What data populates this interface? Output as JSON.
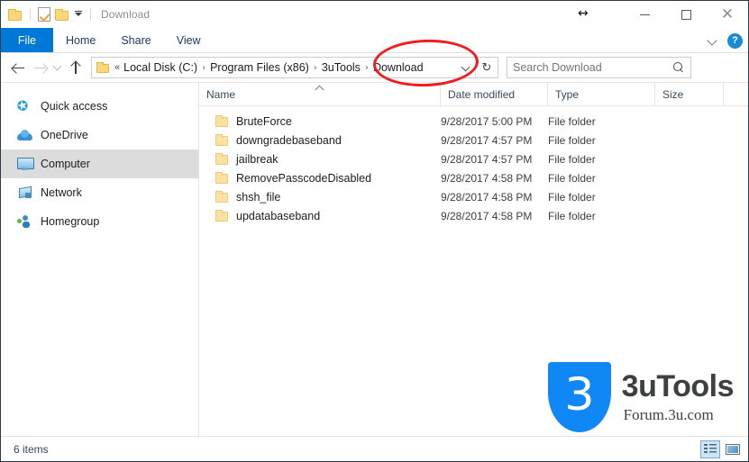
{
  "window": {
    "title": "Download",
    "quick_access_toolbar": [
      {
        "name": "folder-icon",
        "label": "Folder"
      },
      {
        "name": "properties-icon",
        "label": "Properties"
      },
      {
        "name": "new-folder-icon",
        "label": "New folder"
      },
      {
        "name": "customize-dropdown-icon",
        "label": "Customize Quick Access Toolbar"
      }
    ],
    "controls": {
      "minimize": "—",
      "maximize": "□",
      "close": "✕"
    },
    "cursor_glyph": "↔"
  },
  "ribbon": {
    "tabs": [
      {
        "label": "File",
        "selected": true
      },
      {
        "label": "Home",
        "selected": false
      },
      {
        "label": "Share",
        "selected": false
      },
      {
        "label": "View",
        "selected": false
      }
    ],
    "collapse_icon": "chevron-down-icon",
    "help_label": "?"
  },
  "navigation": {
    "back": "←",
    "forward": "→",
    "recent": "⌄",
    "up": "↑",
    "refresh": "↻",
    "dropdown": "⌄"
  },
  "breadcrumb": {
    "overflow": "«",
    "separator": "›",
    "items": [
      {
        "label": "Local Disk (C:)"
      },
      {
        "label": "Program Files (x86)"
      },
      {
        "label": "3uTools"
      },
      {
        "label": "Download"
      }
    ]
  },
  "search": {
    "placeholder": "Search Download",
    "value": ""
  },
  "sidebar": {
    "items": [
      {
        "label": "Quick access",
        "icon": "star-icon",
        "selected": false
      },
      {
        "label": "OneDrive",
        "icon": "cloud-icon",
        "selected": false
      },
      {
        "label": "Computer",
        "icon": "monitor-icon",
        "selected": true
      },
      {
        "label": "Network",
        "icon": "network-icon",
        "selected": false
      },
      {
        "label": "Homegroup",
        "icon": "homegroup-icon",
        "selected": false
      }
    ]
  },
  "filelist": {
    "columns": [
      {
        "label": "Name",
        "sorted": "ascending"
      },
      {
        "label": "Date modified",
        "sorted": ""
      },
      {
        "label": "Type",
        "sorted": ""
      },
      {
        "label": "Size",
        "sorted": ""
      }
    ],
    "rows": [
      {
        "name": "BruteForce",
        "date": "9/28/2017 5:00 PM",
        "type": "File folder",
        "size": ""
      },
      {
        "name": "downgradebaseband",
        "date": "9/28/2017 4:57 PM",
        "type": "File folder",
        "size": ""
      },
      {
        "name": "jailbreak",
        "date": "9/28/2017 4:57 PM",
        "type": "File folder",
        "size": ""
      },
      {
        "name": "RemovePasscodeDisabled",
        "date": "9/28/2017 4:58 PM",
        "type": "File folder",
        "size": ""
      },
      {
        "name": "shsh_file",
        "date": "9/28/2017 4:58 PM",
        "type": "File folder",
        "size": ""
      },
      {
        "name": "updatabaseband",
        "date": "9/28/2017 4:58 PM",
        "type": "File folder",
        "size": ""
      }
    ]
  },
  "statusbar": {
    "item_count": "6 items",
    "view_buttons": [
      {
        "name": "details-view-icon",
        "active": true
      },
      {
        "name": "large-icons-view-icon",
        "active": false
      }
    ]
  },
  "watermark": {
    "logo_char": "3",
    "title": "3uTools",
    "subtitle": "Forum.3u.com"
  },
  "annotation": {
    "shape": "ellipse",
    "color": "#ef1d1d",
    "target": "Download"
  },
  "colors": {
    "accent": "#0078d7",
    "selection": "#dcdcdc",
    "folder": "#fde1a0",
    "annotation": "#ef1d1d",
    "brand_blue": "#0f87f5"
  }
}
